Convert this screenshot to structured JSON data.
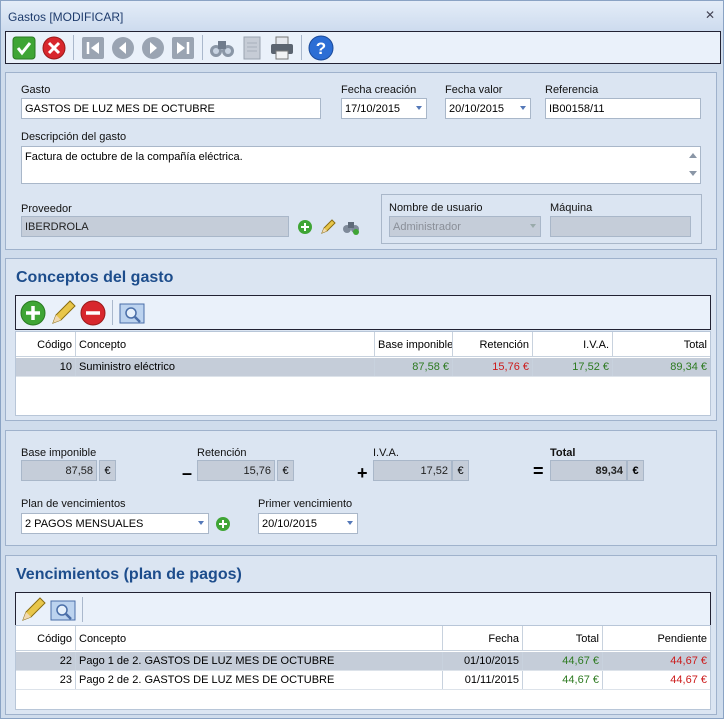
{
  "window": {
    "title": "Gastos [MODIFICAR]",
    "close": "✕"
  },
  "toolbar": {
    "buttons": [
      "accept-icon",
      "cancel-icon",
      "first-icon",
      "prev-icon",
      "next-icon",
      "last-icon",
      "binoculars-icon",
      "document-icon",
      "printer-icon",
      "help-icon"
    ]
  },
  "gasto": {
    "gasto_label": "Gasto",
    "gasto_value": "GASTOS DE LUZ MES DE OCTUBRE",
    "fecha_creacion_label": "Fecha creación",
    "fecha_creacion_value": "17/10/2015",
    "fecha_valor_label": "Fecha valor",
    "fecha_valor_value": "20/10/2015",
    "referencia_label": "Referencia",
    "referencia_value": "IB00158/11",
    "descripcion_label": "Descripción del gasto",
    "descripcion_value": "Factura de octubre de la compañía eléctrica.",
    "proveedor_label": "Proveedor",
    "proveedor_value": "IBERDROLA",
    "usuario_label": "Nombre de usuario",
    "usuario_value": "Administrador",
    "maquina_label": "Máquina",
    "maquina_value": ""
  },
  "conceptos": {
    "title": "Conceptos del gasto",
    "columns": [
      "Código",
      "Concepto",
      "Base imponible",
      "Retención",
      "I.V.A.",
      "Total"
    ],
    "rows": [
      {
        "codigo": "10",
        "concepto": "Suministro eléctrico",
        "base": "87,58 €",
        "retencion": "15,76 €",
        "iva": "17,52 €",
        "total": "89,34 €"
      }
    ]
  },
  "totales": {
    "base_label": "Base imponible",
    "base_value": "87,58",
    "retencion_label": "Retención",
    "retencion_value": "15,76",
    "iva_label": "I.V.A.",
    "iva_value": "17,52",
    "total_label": "Total",
    "total_value": "89,34",
    "currency": "€",
    "minus": "–",
    "plus": "+",
    "equals": "=",
    "plan_label": "Plan de vencimientos",
    "plan_value": "2 PAGOS MENSUALES",
    "primer_label": "Primer vencimiento",
    "primer_value": "20/10/2015"
  },
  "vencimientos": {
    "title": "Vencimientos (plan de pagos)",
    "columns": [
      "Código",
      "Concepto",
      "Fecha",
      "Total",
      "Pendiente"
    ],
    "rows": [
      {
        "codigo": "22",
        "concepto": "Pago 1 de 2. GASTOS DE LUZ MES DE OCTUBRE",
        "fecha": "01/10/2015",
        "total": "44,67 €",
        "pendiente": "44,67 €"
      },
      {
        "codigo": "23",
        "concepto": "Pago 2 de 2. GASTOS DE LUZ MES DE OCTUBRE",
        "fecha": "01/11/2015",
        "total": "44,67 €",
        "pendiente": "44,67 €"
      }
    ]
  },
  "colors": {
    "title": "#1d4d8c",
    "green": "#2d7a20",
    "red": "#cc1a1a",
    "selected_row": "#c5cdd9"
  }
}
